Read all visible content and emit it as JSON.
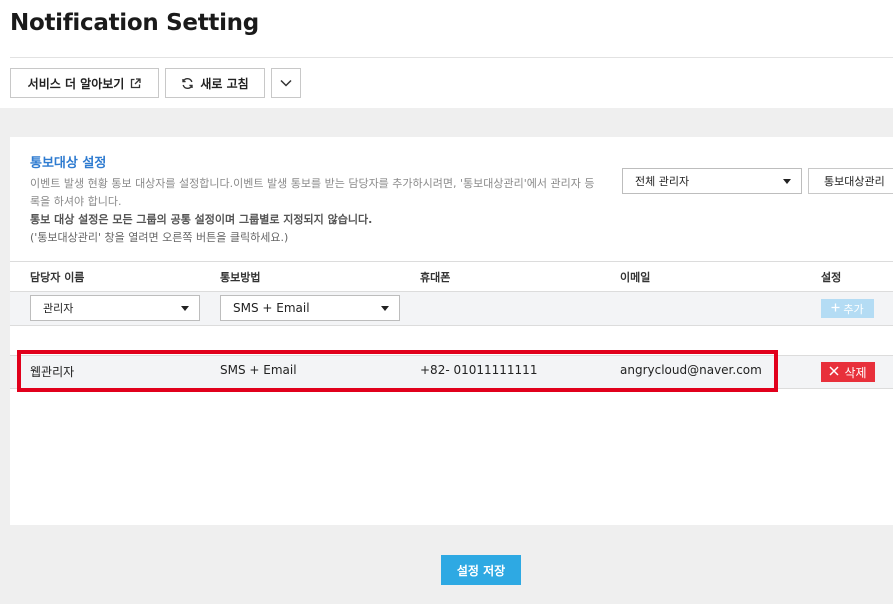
{
  "page": {
    "title": "Notification Setting"
  },
  "toolbar": {
    "learn_more_label": "서비스 더 알아보기",
    "refresh_label": "새로 고침"
  },
  "section": {
    "title": "통보대상 설정",
    "desc_line1": "이벤트 발생 현황 통보 대상자를 설정합니다.이벤트 발생 통보를 받는 담당자를 추가하시려면, '통보대상관리'에서 관리자 등",
    "desc_line2": "록을 하셔야 합니다.",
    "desc_line3": "통보 대상 설정은 모든 그룹의 공통 설정이며 그룹별로 지정되지 않습니다.",
    "desc_line4": "('통보대상관리' 창을 열려면 오른쪽 버튼을 클릭하세요.)",
    "admin_select_value": "전체 관리자",
    "manage_targets_label": "통보대상관리"
  },
  "table": {
    "headers": [
      "담당자 이름",
      "통보방법",
      "휴대폰",
      "이메일",
      "설정"
    ],
    "new_row": {
      "name_select": "관리자",
      "method_select": "SMS + Email",
      "add_label": "추가"
    },
    "rows": [
      {
        "name": "웹관리자",
        "method": "SMS + Email",
        "phone": "+82- 01011111111",
        "email": "angrycloud@naver.com",
        "delete_label": "삭제"
      }
    ]
  },
  "footer": {
    "save_label": "설정 저장"
  },
  "colors": {
    "accent_blue": "#2e7bd0",
    "save_button": "#2ea9e3",
    "delete_button": "#e8303b",
    "highlight_border": "#e1001c",
    "add_button_disabled": "#b4dcf4"
  },
  "icons": {
    "learn_more": "external-link-icon",
    "refresh": "refresh-icon",
    "more": "chevron-down-icon",
    "add": "plus-icon",
    "delete": "close-icon",
    "select_caret": "caret-down-icon"
  }
}
